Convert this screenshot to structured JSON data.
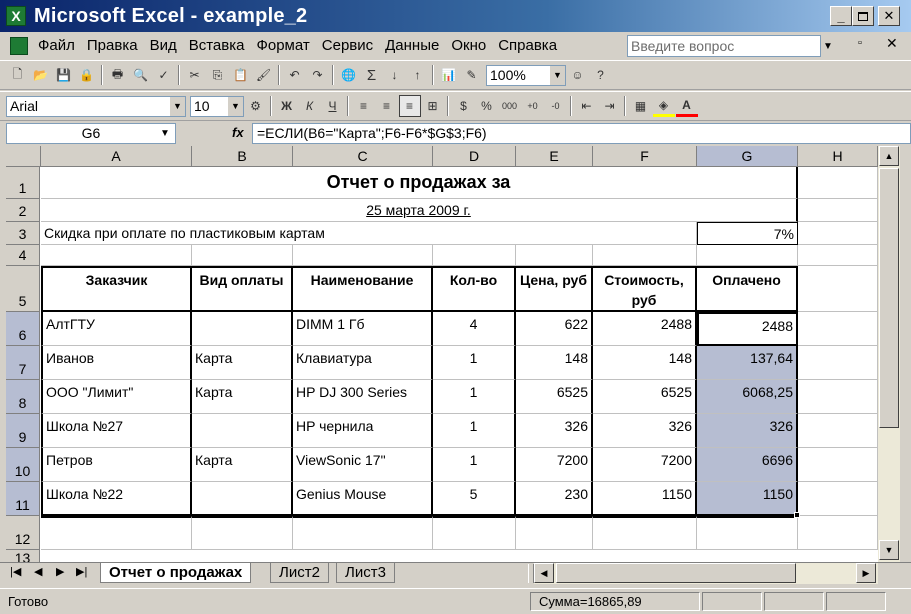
{
  "window": {
    "title": "Microsoft Excel - example_2",
    "icon_letter": "X"
  },
  "menu": [
    "Файл",
    "Правка",
    "Вид",
    "Вставка",
    "Формат",
    "Сервис",
    "Данные",
    "Окно",
    "Справка"
  ],
  "help_placeholder": "Введите вопрос",
  "toolbar": {
    "zoom": "100%",
    "font": "Arial",
    "size": "10"
  },
  "formula": {
    "cell_ref": "G6",
    "fx": "fx",
    "content": "=ЕСЛИ(B6=\"Карта\";F6-F6*$G$3;F6)"
  },
  "columns": [
    "A",
    "B",
    "C",
    "D",
    "E",
    "F",
    "G",
    "H"
  ],
  "rows": [
    "1",
    "2",
    "3",
    "4",
    "5",
    "6",
    "7",
    "8",
    "9",
    "10",
    "11",
    "12",
    "13"
  ],
  "sheet": {
    "title": "Отчет о продажах за",
    "date": "25 марта 2009 г.",
    "discount_label": "Скидка при оплате по пластиковым картам",
    "discount_value": "7%",
    "headers": [
      "Заказчик",
      "Вид оплаты",
      "Наименование",
      "Кол-во",
      "Цена, руб",
      "Стоимость, руб",
      "Оплачено"
    ],
    "data": [
      [
        "АлтГТУ",
        "",
        "DIMM 1 Гб",
        "4",
        "622",
        "2488",
        "2488"
      ],
      [
        "Иванов",
        "Карта",
        "Клавиатура",
        "1",
        "148",
        "148",
        "137,64"
      ],
      [
        "ООО \"Лимит\"",
        "Карта",
        "HP DJ 300 Series",
        "1",
        "6525",
        "6525",
        "6068,25"
      ],
      [
        "Школа №27",
        "",
        "HP чернила",
        "1",
        "326",
        "326",
        "326"
      ],
      [
        "Петров",
        "Карта",
        "ViewSonic 17\"",
        "1",
        "7200",
        "7200",
        "6696"
      ],
      [
        "Школа №22",
        "",
        "Genius Mouse",
        "5",
        "230",
        "1150",
        "1150"
      ]
    ]
  },
  "tabs": [
    "Отчет о продажах",
    "Лист2",
    "Лист3"
  ],
  "status": {
    "ready": "Готово",
    "sum": "Сумма=16865,89"
  }
}
